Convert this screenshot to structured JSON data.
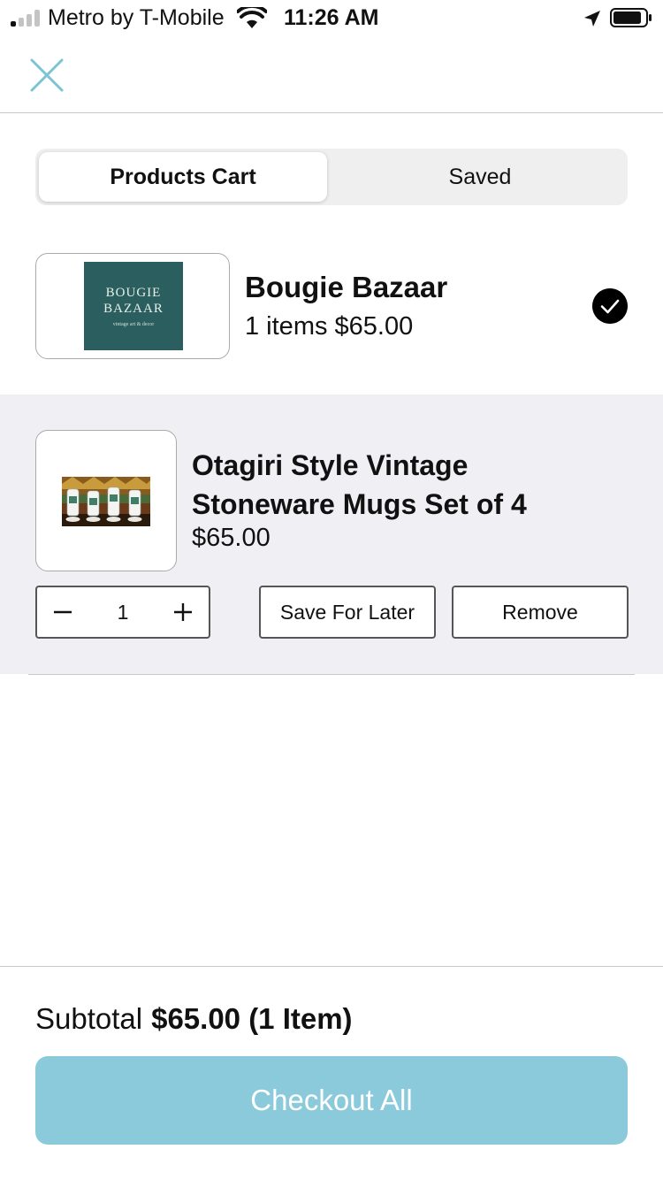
{
  "status_bar": {
    "carrier": "Metro by T-Mobile",
    "time": "11:26 AM",
    "signal_bars_filled": 1,
    "signal_bars_total": 4,
    "battery_level": 0.85
  },
  "header": {
    "close_icon": "close-icon"
  },
  "tabs": [
    {
      "label": "Products Cart",
      "active": true
    },
    {
      "label": "Saved",
      "active": false
    }
  ],
  "store": {
    "logo_line1": "BOUGIE",
    "logo_line2": "BAZAAR",
    "logo_tagline": "vintage art & decor",
    "name": "Bougie Bazaar",
    "summary": "1 items $65.00",
    "selected": true,
    "logo_color": "#2b5e5f"
  },
  "item": {
    "title": "Otagiri Style Vintage Stoneware Mugs Set of 4",
    "price": "$65.00",
    "quantity": "1",
    "save_for_later_label": "Save For Later",
    "remove_label": "Remove"
  },
  "footer": {
    "subtotal_label": "Subtotal",
    "subtotal_value": "$65.00 (1 Item)",
    "checkout_label": "Checkout All",
    "checkout_color": "#8bcadb"
  },
  "colors": {
    "accent": "#8bcadb",
    "close_icon": "#7cc3d6",
    "section_bg": "#efeff4"
  }
}
